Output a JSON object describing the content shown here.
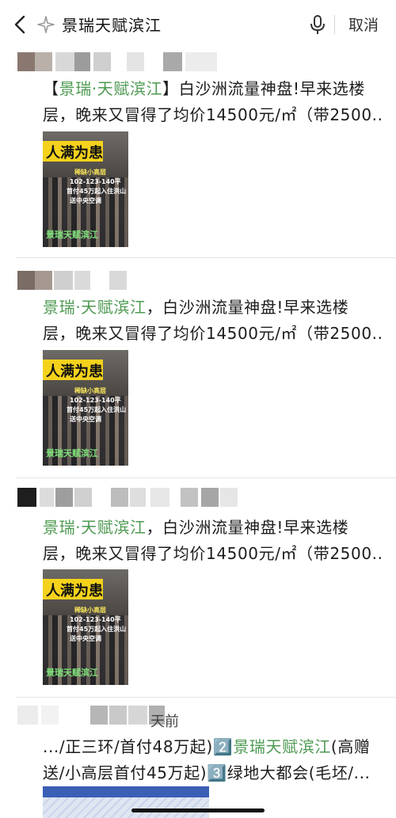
{
  "search": {
    "query": "景瑞天赋滨江",
    "cancel_label": "取消"
  },
  "results": [
    {
      "prefix": "【",
      "highlight": "景瑞·天赋滨江",
      "suffix": "】白沙洲流量神盘!早来选楼",
      "line2": "层，晚来又冒得了均价14500元/㎡（带2500...",
      "thumb": {
        "banner": "人满为患",
        "lines": [
          "稀缺小高层",
          "102-123-140平",
          "首付45万起入住洪山",
          "送中央空调"
        ],
        "brand": "景瑞天赋滨江"
      }
    },
    {
      "prefix": "",
      "highlight": "景瑞·天赋滨江",
      "suffix": "，白沙洲流量神盘!早来选楼",
      "line2": "层，晚来又冒得了均价14500元/㎡（带2500...",
      "thumb": {
        "banner": "人满为患",
        "lines": [
          "稀缺小高层",
          "102-123-140平",
          "首付45万起入住洪山",
          "送中央空调"
        ],
        "brand": "景瑞天赋滨江"
      }
    },
    {
      "prefix": "",
      "highlight": "景瑞·天赋滨江",
      "suffix": "，白沙洲流量神盘!早来选楼",
      "line2": "层，晚来又冒得了均价14500元/㎡（带2500...",
      "thumb": {
        "banner": "人满为患",
        "lines": [
          "稀缺小高层",
          "102-123-140平",
          "首付45万起入住洪山",
          "送中央空调"
        ],
        "brand": "景瑞天赋滨江"
      }
    },
    {
      "meta_suffix": "天前",
      "line1_prefix": ".../正三环/首付48万起)2️⃣",
      "line1_highlight": "景瑞天赋滨江",
      "line1_suffix": "(高赠",
      "line2": "送/小高层首付45万起)3️⃣绿地大都会(毛坯/..."
    }
  ],
  "colors": {
    "highlight": "#4e9a52",
    "banner": "#f4d21c"
  },
  "icons": {
    "back": "chevron-left-icon",
    "search": "search-icon",
    "mic": "microphone-icon"
  }
}
